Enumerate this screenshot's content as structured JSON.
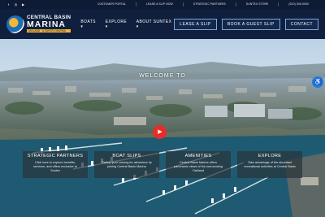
{
  "topbar": {
    "social": [
      {
        "icon": "facebook-icon",
        "glyph": "f"
      },
      {
        "icon": "instagram-icon",
        "glyph": "◎"
      },
      {
        "icon": "youtube-icon",
        "glyph": "▶"
      }
    ],
    "links": [
      "CUSTOMER PORTAL",
      "LEASE A SLIP NOW",
      "STRATEGIC PARTNERS",
      "SUNTEX STORE",
      "(510) 000-0000"
    ]
  },
  "header": {
    "logo": {
      "line1": "CENTRAL BASIN",
      "line2": "MARINA",
      "line3": "OAKLAND · A SUNTEX MARINA"
    },
    "nav": [
      {
        "label": "BOATS",
        "caret": "▾"
      },
      {
        "label": "EXPLORE",
        "caret": "▾"
      },
      {
        "label": "ABOUT SUNTEX",
        "caret": "▾"
      }
    ],
    "buttons": [
      "LEASE A SLIP",
      "BOOK A GUEST SLIP",
      "CONTACT"
    ]
  },
  "hero": {
    "title": "WELCOME TO",
    "play_glyph": "▶",
    "accessibility_glyph": "♿"
  },
  "cards": [
    {
      "title": "STRATEGIC PARTNERS",
      "text": "Click here to explore benefits, services, and offers exclusive to Suntex"
    },
    {
      "title": "BOAT SLIPS",
      "text": "Satisfy your craving for adventure by joining Central Basin Marina"
    },
    {
      "title": "AMENITIES",
      "text": "Central Basin Marina offers panoramic views of the surrounding Oakland"
    },
    {
      "title": "EXPLORE",
      "text": "Take advantage of the abundant recreational activities at Central Basin"
    }
  ],
  "colors": {
    "nav_bg": "#0f1f3d",
    "accent": "#f3b63a",
    "play": "#e52d27"
  }
}
